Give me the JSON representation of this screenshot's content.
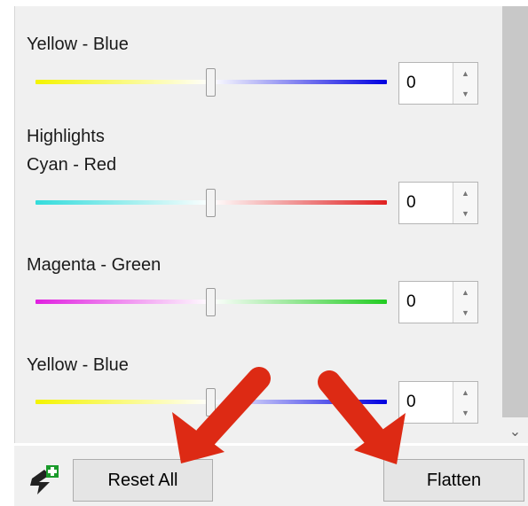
{
  "sections": [
    {
      "label": "Yellow - Blue",
      "value": "0",
      "gradient": [
        "#f4f400",
        "#ffffff",
        "#0000e0"
      ]
    },
    {
      "heading": "Highlights",
      "label": "Cyan - Red",
      "value": "0",
      "gradient": [
        "#33dcdc",
        "#ffffff",
        "#e02020"
      ]
    },
    {
      "label": "Magenta - Green",
      "value": "0",
      "gradient": [
        "#e020e0",
        "#ffffff",
        "#22cc22"
      ]
    },
    {
      "label": "Yellow - Blue",
      "value": "0",
      "gradient": [
        "#f4f400",
        "#ffffff",
        "#0000e0"
      ]
    }
  ],
  "toolbar": {
    "reset_label": "Reset All",
    "flatten_label": "Flatten",
    "icon": "add-layer-icon"
  },
  "annotation": {
    "arrow_color": "#dd2a14"
  }
}
